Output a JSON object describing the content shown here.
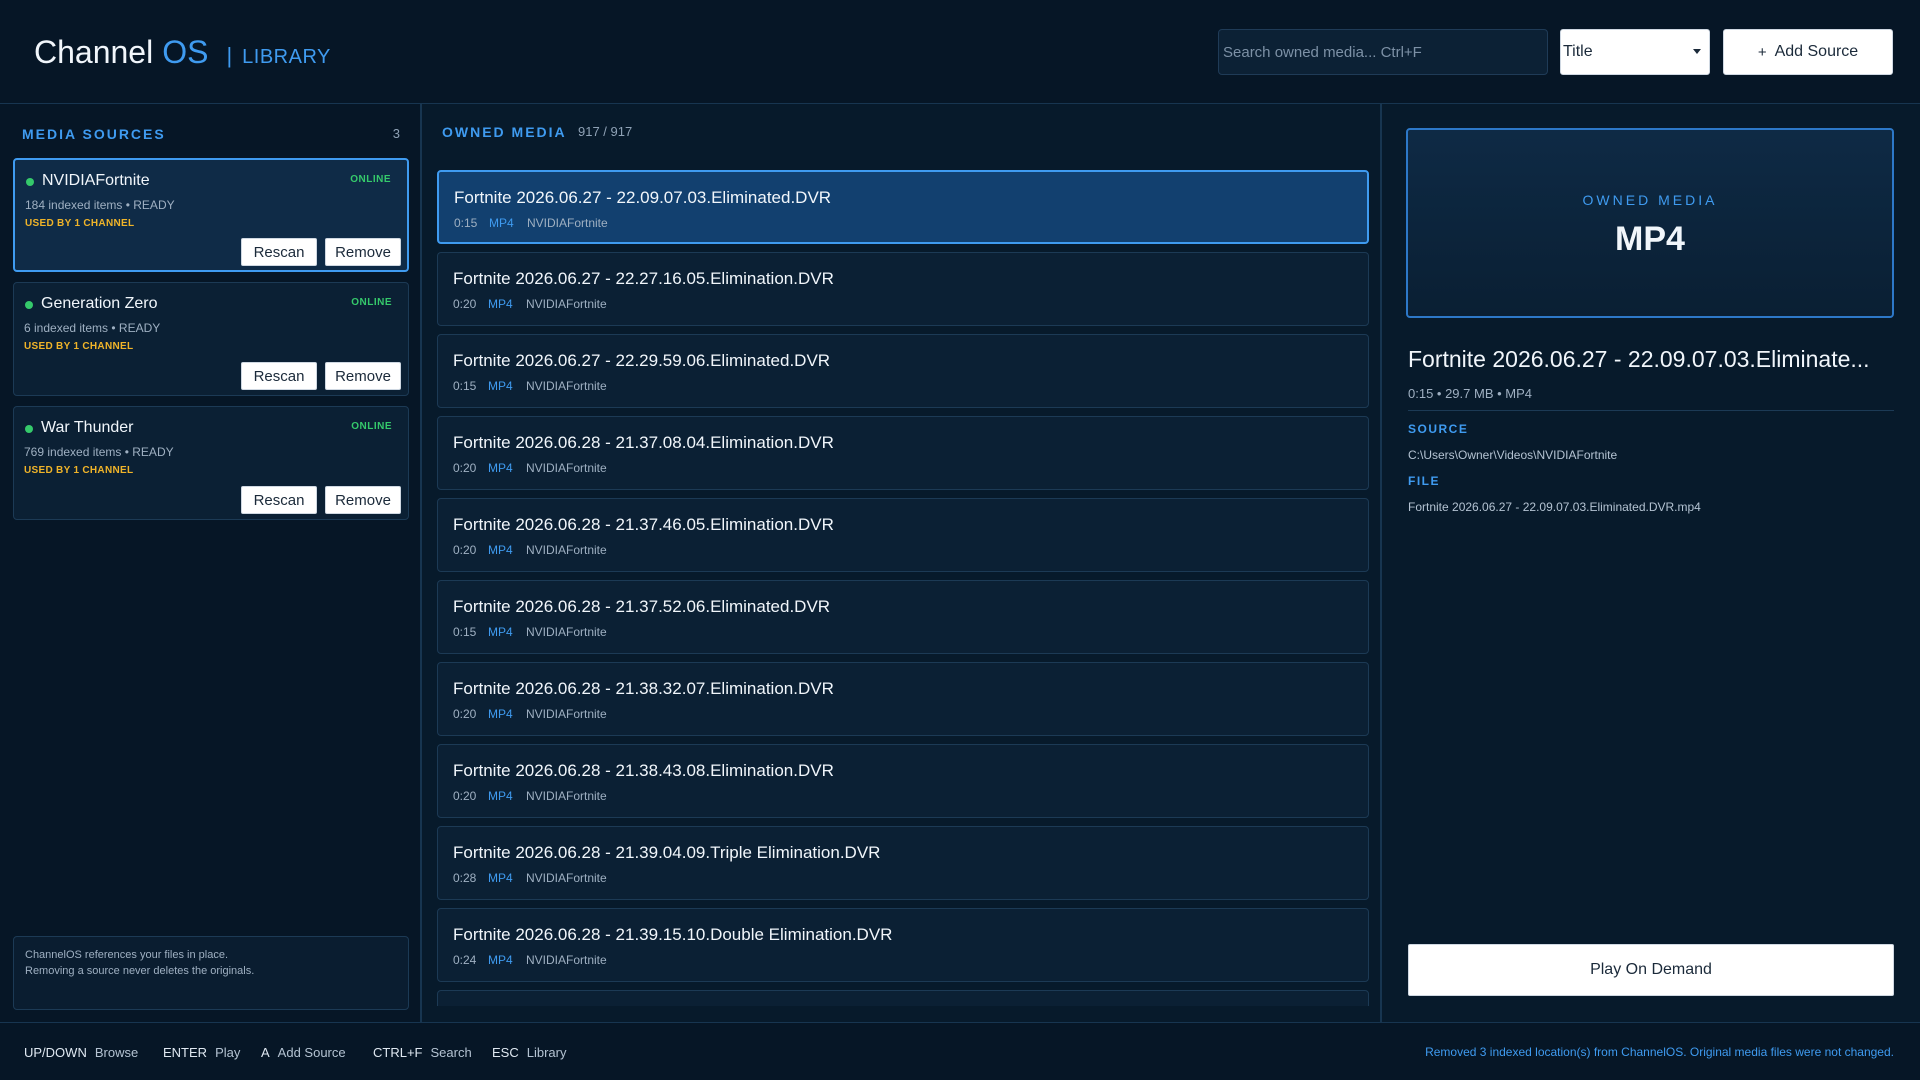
{
  "header": {
    "brand_name": "Channel",
    "brand_os": "OS",
    "separator": "|",
    "section": "LIBRARY",
    "search_placeholder": "Search owned media...  Ctrl+F",
    "sort_value": "Title",
    "add_source_label": "Add Source"
  },
  "sources": {
    "title": "MEDIA SOURCES",
    "count": "3",
    "items": [
      {
        "name": "NVIDIAFortnite",
        "status": "ONLINE",
        "meta": "184 indexed items  •  READY",
        "used": "USED BY 1 CHANNEL",
        "rescan": "Rescan",
        "remove": "Remove"
      },
      {
        "name": "Generation Zero",
        "status": "ONLINE",
        "meta": "6 indexed items  •  READY",
        "used": "USED BY 1 CHANNEL",
        "rescan": "Rescan",
        "remove": "Remove"
      },
      {
        "name": "War Thunder",
        "status": "ONLINE",
        "meta": "769 indexed items  •  READY",
        "used": "USED BY 1 CHANNEL",
        "rescan": "Rescan",
        "remove": "Remove"
      }
    ],
    "note_line1": "ChannelOS references your files in place.",
    "note_line2": "Removing a source never deletes the originals."
  },
  "media": {
    "title": "OWNED MEDIA",
    "count": "917 / 917",
    "items": [
      {
        "title": "Fortnite 2026.06.27 - 22.09.07.03.Eliminated.DVR",
        "duration": "0:15",
        "format": "MP4",
        "source": "NVIDIAFortnite"
      },
      {
        "title": "Fortnite 2026.06.27 - 22.27.16.05.Elimination.DVR",
        "duration": "0:20",
        "format": "MP4",
        "source": "NVIDIAFortnite"
      },
      {
        "title": "Fortnite 2026.06.27 - 22.29.59.06.Eliminated.DVR",
        "duration": "0:15",
        "format": "MP4",
        "source": "NVIDIAFortnite"
      },
      {
        "title": "Fortnite 2026.06.28 - 21.37.08.04.Elimination.DVR",
        "duration": "0:20",
        "format": "MP4",
        "source": "NVIDIAFortnite"
      },
      {
        "title": "Fortnite 2026.06.28 - 21.37.46.05.Elimination.DVR",
        "duration": "0:20",
        "format": "MP4",
        "source": "NVIDIAFortnite"
      },
      {
        "title": "Fortnite 2026.06.28 - 21.37.52.06.Eliminated.DVR",
        "duration": "0:15",
        "format": "MP4",
        "source": "NVIDIAFortnite"
      },
      {
        "title": "Fortnite 2026.06.28 - 21.38.32.07.Elimination.DVR",
        "duration": "0:20",
        "format": "MP4",
        "source": "NVIDIAFortnite"
      },
      {
        "title": "Fortnite 2026.06.28 - 21.38.43.08.Elimination.DVR",
        "duration": "0:20",
        "format": "MP4",
        "source": "NVIDIAFortnite"
      },
      {
        "title": "Fortnite 2026.06.28 - 21.39.04.09.Triple Elimination.DVR",
        "duration": "0:28",
        "format": "MP4",
        "source": "NVIDIAFortnite"
      },
      {
        "title": "Fortnite 2026.06.28 - 21.39.15.10.Double Elimination.DVR",
        "duration": "0:24",
        "format": "MP4",
        "source": "NVIDIAFortnite"
      }
    ]
  },
  "detail": {
    "preview_label": "OWNED MEDIA",
    "preview_format": "MP4",
    "title": "Fortnite 2026.06.27 - 22.09.07.03.Eliminate...",
    "meta": "0:15  •  29.7 MB  •  MP4",
    "source_label": "SOURCE",
    "source_value": "C:\\Users\\Owner\\Videos\\NVIDIAFortnite",
    "file_label": "FILE",
    "file_value": "Fortnite 2026.06.27 - 22.09.07.03.Eliminated.DVR.mp4",
    "play_label": "Play On Demand"
  },
  "footer": {
    "hints": [
      {
        "key": "UP/DOWN",
        "label": "Browse"
      },
      {
        "key": "ENTER",
        "label": "Play"
      },
      {
        "key": "A",
        "label": "Add Source"
      },
      {
        "key": "CTRL+F",
        "label": "Search"
      },
      {
        "key": "ESC",
        "label": "Library"
      }
    ],
    "message": "Removed 3 indexed location(s) from ChannelOS. Original media files were not changed."
  },
  "colors": {
    "accent": "#3f9bf0",
    "online": "#35c96b",
    "used": "#f0b429",
    "background": "#071a2b"
  }
}
